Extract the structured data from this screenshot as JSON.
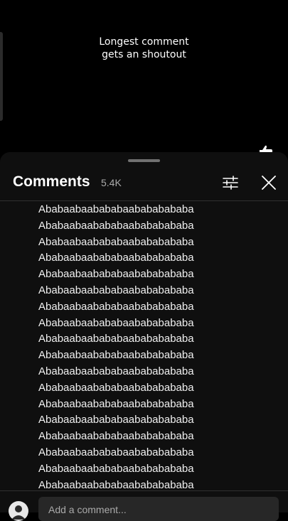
{
  "video": {
    "caption_lines": [
      "Longest comment",
      "gets an shoutout"
    ]
  },
  "comments_panel": {
    "title": "Comments",
    "count": "5.4K",
    "filter_icon": "tune-icon",
    "close_icon": "close-icon",
    "comment_lines": [
      "Ababaabaabababaabababababa",
      "Ababaabaabababaabababababa",
      "Ababaabaabababaabababababa",
      "Ababaabaabababaabababababa",
      "Ababaabaabababaabababababa",
      "Ababaabaabababaabababababa",
      "Ababaabaabababaabababababa",
      "Ababaabaabababaabababababa",
      "Ababaabaabababaabababababa",
      "Ababaabaabababaabababababa",
      "Ababaabaabababaabababababa",
      "Ababaabaabababaabababababa",
      "Ababaabaabababaabababababa",
      "Ababaabaabababaabababababa",
      "Ababaabaabababaabababababa",
      "Ababaabaabababaabababababa",
      "Ababaabaabababaabababababa",
      "Ababaabaabababaabababababa"
    ]
  },
  "footer": {
    "add_comment_placeholder": "Add a comment..."
  },
  "colors": {
    "sheet_background": "#0f0f0f",
    "text_primary": "#f1f1f1",
    "text_secondary": "#aaaaaa"
  }
}
